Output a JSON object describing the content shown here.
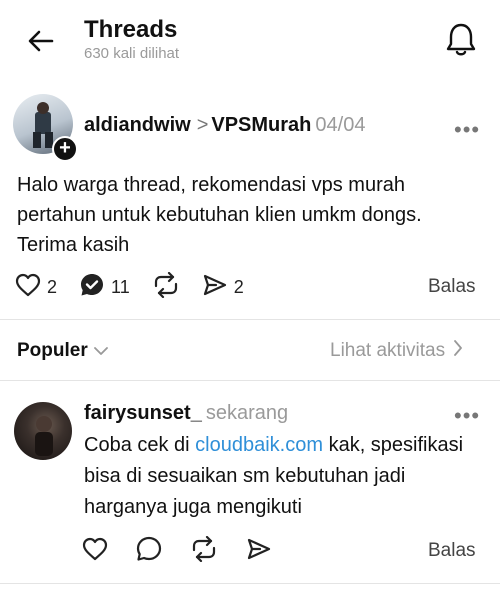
{
  "header": {
    "title": "Threads",
    "subtitle": "630 kali dilihat"
  },
  "post": {
    "author": "aldiandwiw",
    "separator": ">",
    "reply_to": "VPSMurah",
    "thread_position": "04/04",
    "more": "•••",
    "text": "Halo warga thread, rekomendasi vps murah pertahun untuk kebutuhan klien umkm dongs. Terima kasih",
    "likes": "2",
    "replies": "11",
    "shares": "2",
    "reply_label": "Balas"
  },
  "sort_bar": {
    "sort_label": "Populer",
    "activity_label": "Lihat aktivitas"
  },
  "reply": {
    "author": "fairysunset_",
    "time": "sekarang",
    "more": "•••",
    "text_before": "Coba cek di ",
    "link": "cloudbaik.com",
    "text_after": " kak, spesifikasi bisa di sesuaikan sm kebutuhan jadi harganya juga mengikuti",
    "reply_label": "Balas"
  },
  "icons": {
    "back": "arrow-left-icon",
    "notifications": "bell-icon",
    "like": "heart-icon",
    "comment": "comment-check-icon",
    "repost": "repost-icon",
    "share": "send-icon",
    "comment_reply": "comment-icon"
  }
}
